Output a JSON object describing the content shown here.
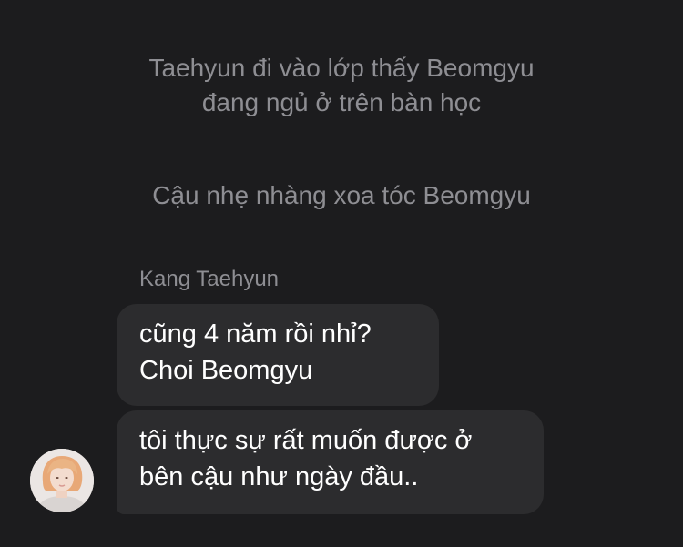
{
  "narration": [
    {
      "lines": [
        "Taehyun đi vào lớp thấy Beomgyu",
        "đang ngủ ở trên bàn học"
      ]
    },
    {
      "lines": [
        "Cậu nhẹ nhàng xoa tóc Beomgyu"
      ]
    }
  ],
  "chat": {
    "sender_name": "Kang Taehyun",
    "messages": [
      {
        "lines": [
          "cũng 4 năm rồi nhỉ?",
          "Choi Beomgyu"
        ]
      },
      {
        "lines": [
          "tôi thực sự rất muốn được ở",
          "bên cậu như ngày đầu.."
        ]
      }
    ],
    "avatar_icon": "profile-photo-icon"
  },
  "colors": {
    "background": "#1c1c1e",
    "bubble": "#2c2c2e",
    "secondary_text": "#8e8e93",
    "primary_text": "#ffffff",
    "avatar_hair": "#e8a877"
  }
}
